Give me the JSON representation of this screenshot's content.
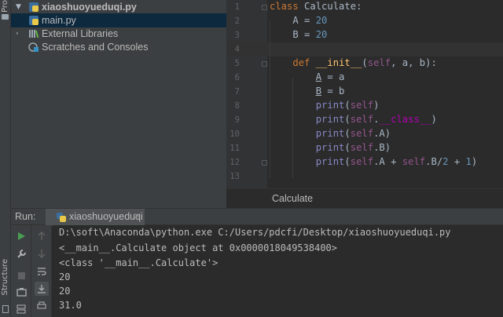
{
  "side_strip": {
    "project_label": "Pro",
    "structure_label": "Structure"
  },
  "project_tree": [
    {
      "label": "xiaoshuoyueduqi.py",
      "bold": true,
      "icon": "python-file-icon",
      "chevron": "open"
    },
    {
      "label": "main.py",
      "bold": false,
      "icon": "python-file-icon",
      "selected": true
    },
    {
      "label": "External Libraries",
      "bold": false,
      "icon": "libraries-icon",
      "chevron": "closed"
    },
    {
      "label": "Scratches and Consoles",
      "bold": false,
      "icon": "scratches-icon"
    }
  ],
  "editor": {
    "line_numbers": [
      "1",
      "2",
      "3",
      "4",
      "5",
      "6",
      "7",
      "8",
      "9",
      "10",
      "11",
      "12",
      "13"
    ],
    "current_line": "4",
    "breadcrumb": "Calculate"
  },
  "code": {
    "l1_kw": "class",
    "l1_name": "Calculate",
    "l1_colon": ":",
    "l2": "A = ",
    "l2_num": "20",
    "l3": "B = ",
    "l3_num": "20",
    "l5_kw": "def",
    "l5_fn": "__init__",
    "l5_open": "(",
    "l5_self": "self",
    "l5_rest": ", a, b):",
    "l6_attr": "A",
    "l6_rest": " = a",
    "l7_attr": "B",
    "l7_rest": " = b",
    "print": "print",
    "l8_open": "(",
    "self": "self",
    "close": ")",
    "l9_dot": ".",
    "l9_attr": "__class__",
    "l10_dot": ".A",
    "l11_dot": ".B",
    "l12_a": ".A + ",
    "l12_b": ".B/",
    "l12_n2": "2",
    "l12_plus": " + ",
    "l12_n1": "1"
  },
  "run": {
    "label": "Run:",
    "tab_label": "xiaoshuoyueduqi",
    "close_glyph": "✕",
    "console_lines": [
      "D:\\soft\\Anaconda\\python.exe C:/Users/pdcfi/Desktop/xiaoshuoyueduqi.py",
      "<__main__.Calculate object at 0x0000018049538400>",
      "<class '__main__.Calculate'>",
      "20",
      "20",
      "31.0"
    ]
  },
  "colors": {
    "keyword": "#cc7832",
    "function": "#ffc66d",
    "number": "#6897bb",
    "self": "#94558d",
    "builtin": "#8888c6",
    "run_green": "#499c54"
  }
}
